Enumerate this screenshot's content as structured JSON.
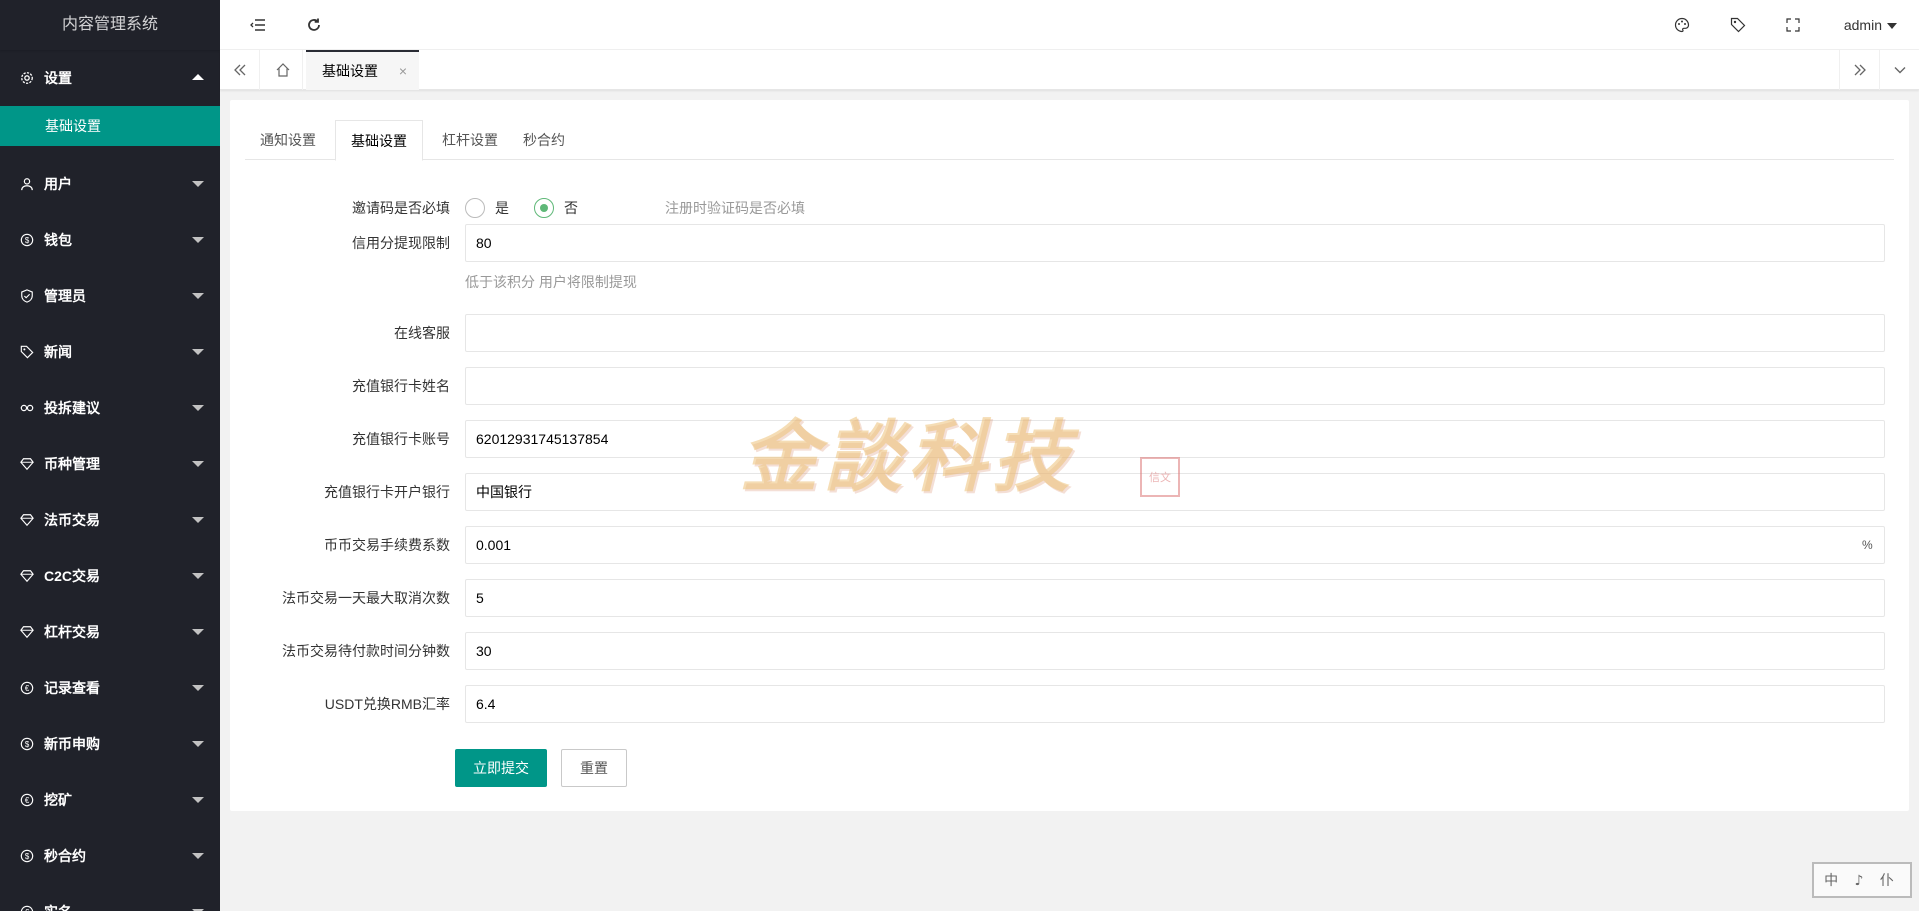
{
  "app": {
    "title": "内容管理系统"
  },
  "sidebar": {
    "items": [
      {
        "label": "设置",
        "icon": "gear-icon",
        "expanded": true,
        "children": [
          {
            "label": "基础设置"
          }
        ]
      },
      {
        "label": "用户",
        "icon": "user-icon"
      },
      {
        "label": "钱包",
        "icon": "dollar-icon"
      },
      {
        "label": "管理员",
        "icon": "shield-icon"
      },
      {
        "label": "新闻",
        "icon": "tag-icon"
      },
      {
        "label": "投拆建议",
        "icon": "link-icon"
      },
      {
        "label": "币种管理",
        "icon": "diamond-icon"
      },
      {
        "label": "法币交易",
        "icon": "diamond-icon"
      },
      {
        "label": "C2C交易",
        "icon": "diamond-icon"
      },
      {
        "label": "杠杆交易",
        "icon": "diamond-icon"
      },
      {
        "label": "记录查看",
        "icon": "euro-icon"
      },
      {
        "label": "新币申购",
        "icon": "dollar-icon"
      },
      {
        "label": "挖矿",
        "icon": "euro-icon"
      },
      {
        "label": "秒合约",
        "icon": "dollar-icon"
      },
      {
        "label": "实名",
        "icon": "euro-icon"
      }
    ]
  },
  "header": {
    "user": "admin",
    "icons": [
      "menu-collapse-icon",
      "refresh-icon",
      "palette-icon",
      "tag-icon",
      "fullscreen-icon"
    ]
  },
  "tabsbar": {
    "active_tab": "基础设置",
    "close": "×"
  },
  "form_tabs": [
    "通知设置",
    "基础设置",
    "杠杆设置",
    "秒合约"
  ],
  "active_form_tab": 1,
  "form": {
    "invite_required": {
      "label": "邀请码是否必填",
      "options": [
        "是",
        "否"
      ],
      "selected": "否",
      "aux": "注册时验证码是否必填"
    },
    "credit_limit": {
      "label": "信用分提现限制",
      "value": "80",
      "hint": "低于该积分 用户将限制提现"
    },
    "online_service": {
      "label": "在线客服",
      "value": ""
    },
    "bank_name": {
      "label": "充值银行卡姓名",
      "value": ""
    },
    "bank_account": {
      "label": "充值银行卡账号",
      "value": "62012931745137854"
    },
    "bank_open": {
      "label": "充值银行卡开户银行",
      "value": "中国银行"
    },
    "fee_rate": {
      "label": "币币交易手续费系数",
      "value": "0.001",
      "suffix": "%"
    },
    "max_cancel": {
      "label": "法币交易一天最大取消次数",
      "value": "5"
    },
    "pay_wait": {
      "label": "法币交易待付款时间分钟数",
      "value": "30"
    },
    "usdt_rmb": {
      "label": "USDT兑换RMB汇率",
      "value": "6.4"
    }
  },
  "buttons": {
    "submit": "立即提交",
    "reset": "重置"
  },
  "watermark": {
    "text": "金談科技",
    "seal": "信文"
  },
  "corner_stamp": "中 ♪ 仆",
  "colors": {
    "sidebar": "#20222a",
    "accent": "#009688",
    "radio": "#5FB878"
  }
}
